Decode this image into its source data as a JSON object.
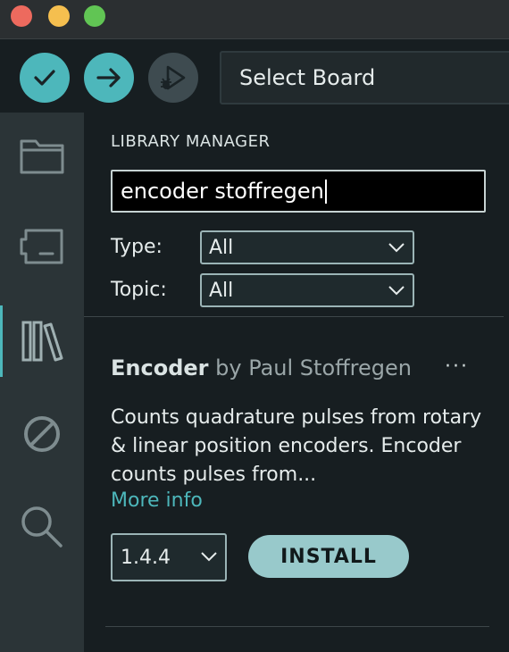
{
  "titlebar": {
    "colors": {
      "close": "#ed6a5e",
      "minimize": "#f5bf4f",
      "zoom": "#61c554"
    }
  },
  "toolbar": {
    "verify_icon": "checkmark-icon",
    "upload_icon": "arrow-right-icon",
    "debug_icon": "debug-icon",
    "board_select_label": "Select Board"
  },
  "sidebar": {
    "items": [
      {
        "icon": "folder-icon",
        "active": false
      },
      {
        "icon": "board-manager-icon",
        "active": false
      },
      {
        "icon": "library-icon",
        "active": true
      },
      {
        "icon": "debug-disabled-icon",
        "active": false
      },
      {
        "icon": "search-icon",
        "active": false
      }
    ]
  },
  "library_manager": {
    "title": "LIBRARY MANAGER",
    "search_value": "encoder stoffregen",
    "type_label": "Type:",
    "type_value": "All",
    "topic_label": "Topic:",
    "topic_value": "All",
    "result": {
      "name": "Encoder",
      "author": " by Paul Stoffregen",
      "more_menu": "···",
      "description": "Counts quadrature pulses from rotary & linear position encoders. Encoder counts pulses from...",
      "more_info": "More info",
      "version": "1.4.4",
      "install_label": "INSTALL"
    }
  },
  "colors": {
    "accent": "#4db7bb",
    "install_button": "#98c9cb",
    "background": "#171e21",
    "sidebar": "#2b3437"
  }
}
